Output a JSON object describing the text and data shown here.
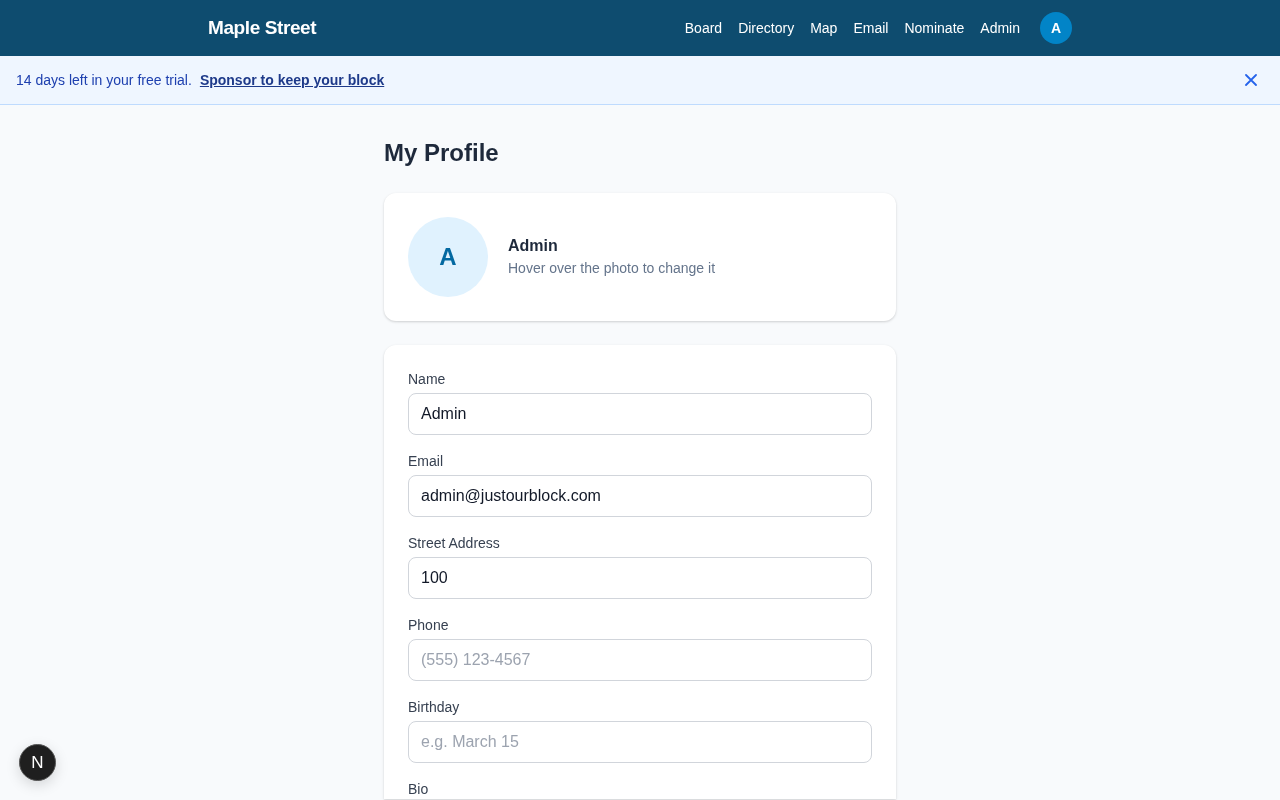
{
  "header": {
    "brand": "Maple Street",
    "nav": [
      {
        "label": "Board"
      },
      {
        "label": "Directory"
      },
      {
        "label": "Map"
      },
      {
        "label": "Email"
      },
      {
        "label": "Nominate"
      },
      {
        "label": "Admin"
      }
    ],
    "avatar_initial": "A"
  },
  "trial_banner": {
    "message": "14 days left in your free trial.",
    "link": "Sponsor to keep your block"
  },
  "page_title": "My Profile",
  "profile_card": {
    "initial": "A",
    "name": "Admin",
    "hint": "Hover over the photo to change it"
  },
  "form": {
    "fields": [
      {
        "label": "Name",
        "value": "Admin"
      },
      {
        "label": "Email",
        "value": "admin@justourblock.com"
      },
      {
        "label": "Street Address",
        "value": "100"
      },
      {
        "label": "Phone",
        "placeholder": "(555) 123-4567"
      },
      {
        "label": "Birthday",
        "placeholder": "e.g. March 15"
      },
      {
        "label": "Bio"
      }
    ]
  },
  "dev_badge": {
    "label": "N"
  }
}
